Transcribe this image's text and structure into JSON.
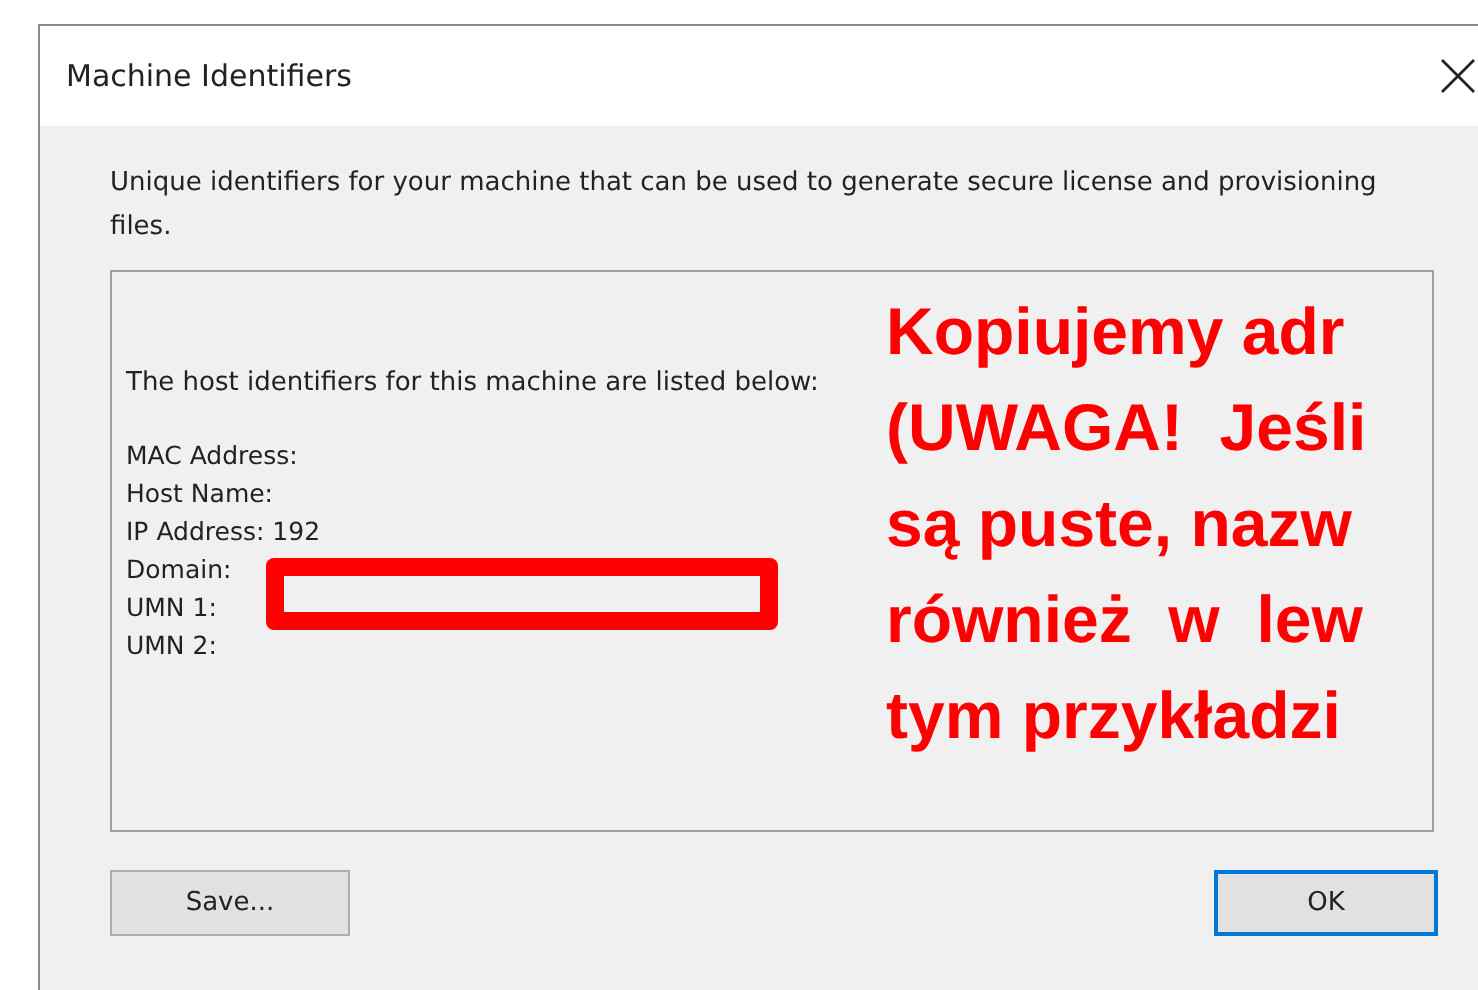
{
  "window": {
    "title": "Machine Identifiers"
  },
  "description": "Unique identifiers for your machine that can be used to generate secure license and provisioning files.",
  "panel": {
    "heading": "The host identifiers for this machine are listed below:",
    "fields": [
      {
        "label": "MAC Address:"
      },
      {
        "label": "Host Name:"
      },
      {
        "label": "IP Address: 192"
      },
      {
        "label": "Domain:"
      },
      {
        "label": "UMN 1:"
      },
      {
        "label": "UMN 2:"
      }
    ]
  },
  "annotation": {
    "lines": [
      "Kopiujemy adr",
      "(UWAGA!  Jeśli",
      "są puste, nazw",
      "również  w  lew",
      "tym przykładzi"
    ]
  },
  "buttons": [
    {
      "label": "Save...",
      "default": false
    },
    {
      "label": "OK",
      "default": true
    }
  ]
}
